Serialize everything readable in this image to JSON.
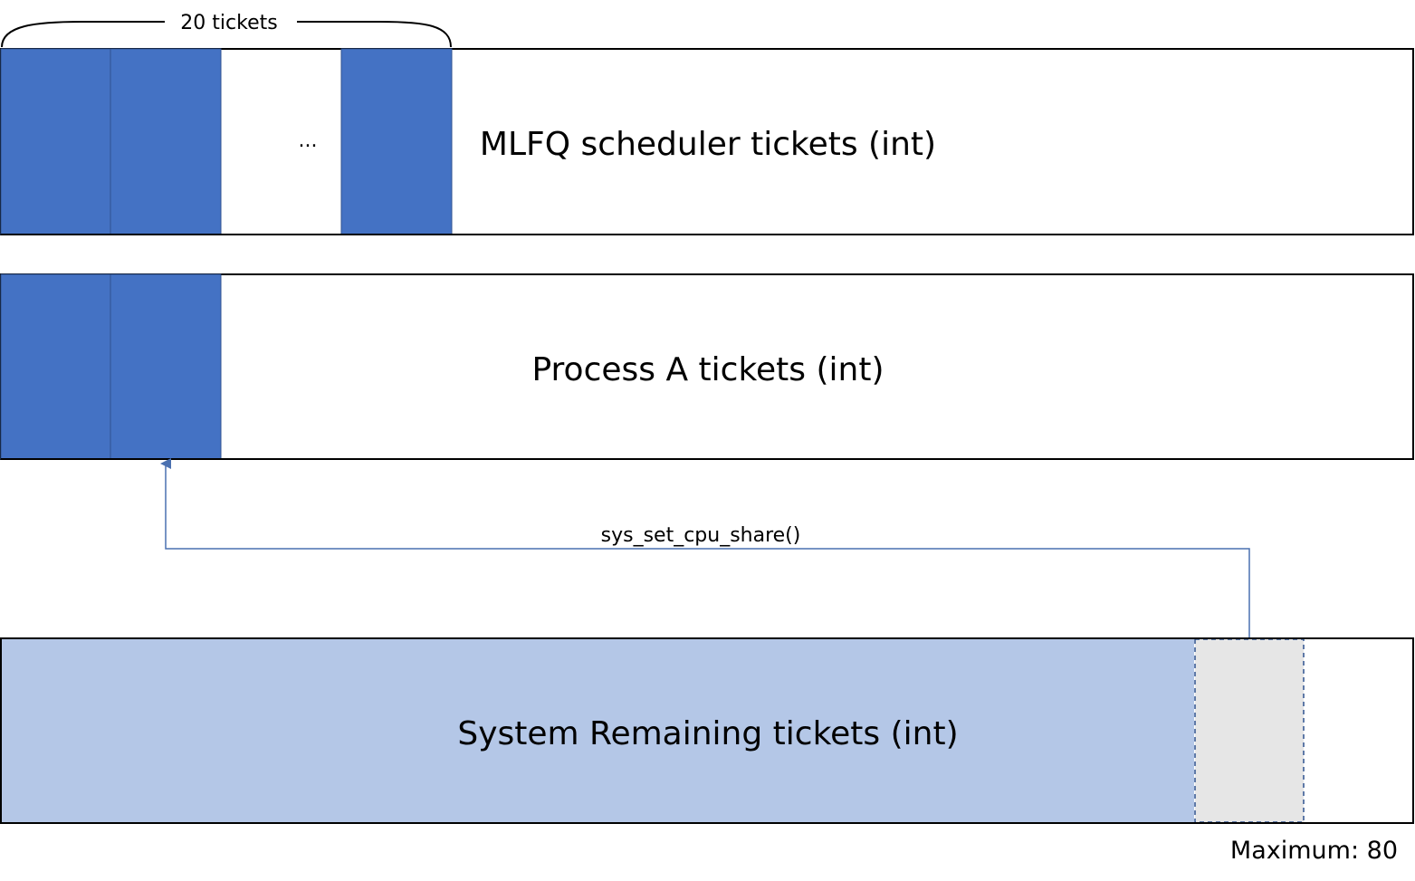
{
  "brace": {
    "label": "20 tickets"
  },
  "rows": [
    {
      "id": "mlfq",
      "label": "MLFQ scheduler tickets (int)",
      "ellipsis": "..."
    },
    {
      "id": "process-a",
      "label": "Process A tickets (int)"
    },
    {
      "id": "system",
      "label": "System Remaining tickets (int)"
    }
  ],
  "arrow": {
    "label": "sys_set_cpu_share()"
  },
  "maximum": {
    "label": "Maximum: 80"
  },
  "colors": {
    "ticket": "#4472C4",
    "remaining": "#B4C7E7",
    "transfer": "#E6E6E6",
    "arrow": "#4A70B0",
    "border": "#000000"
  }
}
